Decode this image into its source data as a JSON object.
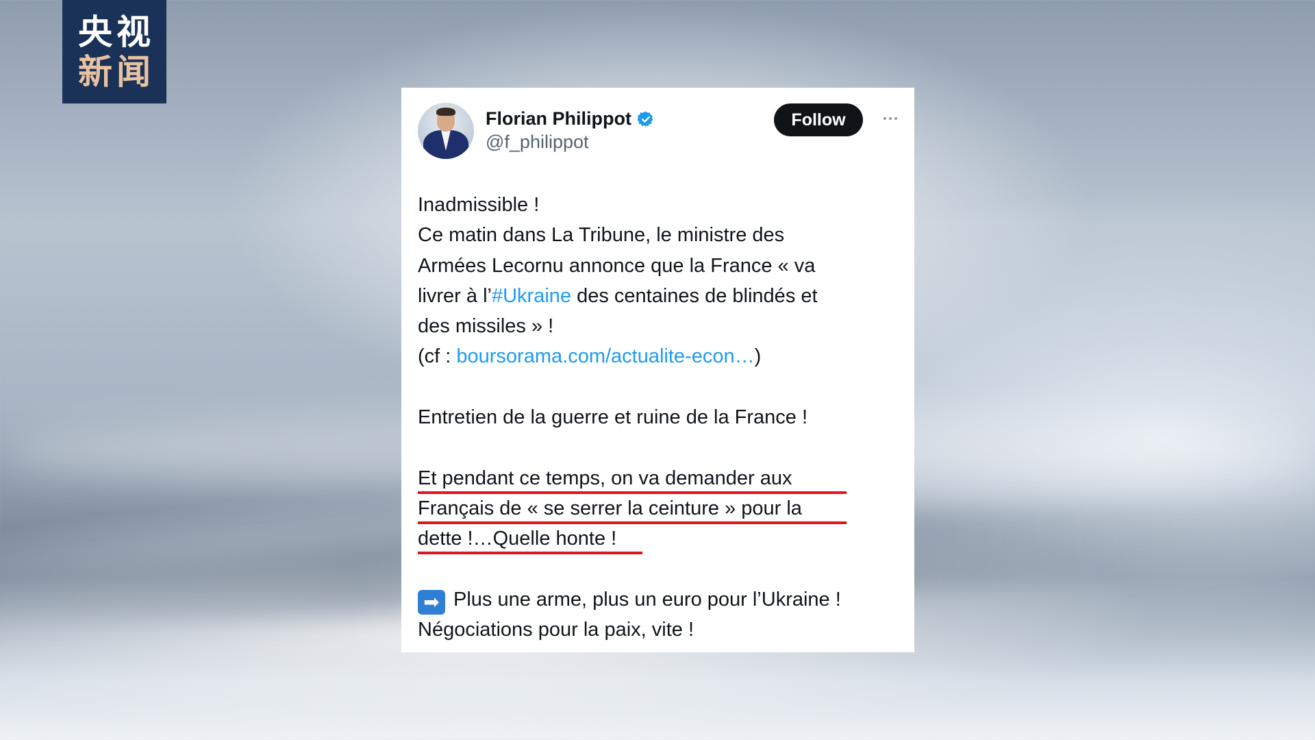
{
  "logo": {
    "line1_char1": "央",
    "line1_char2": "视",
    "line2_char1": "新",
    "line2_char2": "闻"
  },
  "tweet": {
    "author_name": "Florian Philippot",
    "author_handle": "@f_philippot",
    "verified_icon": "verified-badge-icon",
    "follow_label": "Follow",
    "more_icon": "more-options-icon",
    "lines": {
      "l1": "Inadmissible !",
      "l2": "Ce matin dans La Tribune, le ministre des",
      "l3": "Armées Lecornu annonce que la France « va",
      "l4_pre": "livrer à l’",
      "l4_hashtag": "#Ukraine",
      "l4_post": " des centaines de blindés et",
      "l5": "des missiles » !",
      "l6_pre": "(cf : ",
      "l6_link": "boursorama.com/actualite-econ…",
      "l6_post": ")",
      "l7": "Entretien de la guerre et ruine de la France !",
      "l8": "Et pendant ce temps, on va demander aux",
      "l9": "Français de « se serrer la ceinture » pour la",
      "l10": "dette !…Quelle honte !",
      "l11_emoji": "➡",
      "l11_text": "Plus une arme, plus un euro pour l’Ukraine !",
      "l12": "Négociations pour la paix, vite !"
    }
  },
  "colors": {
    "link": "#1d9bf0",
    "underline": "#e3141f",
    "verified": "#1d9bf0",
    "logo_bg": "#1a3158"
  }
}
